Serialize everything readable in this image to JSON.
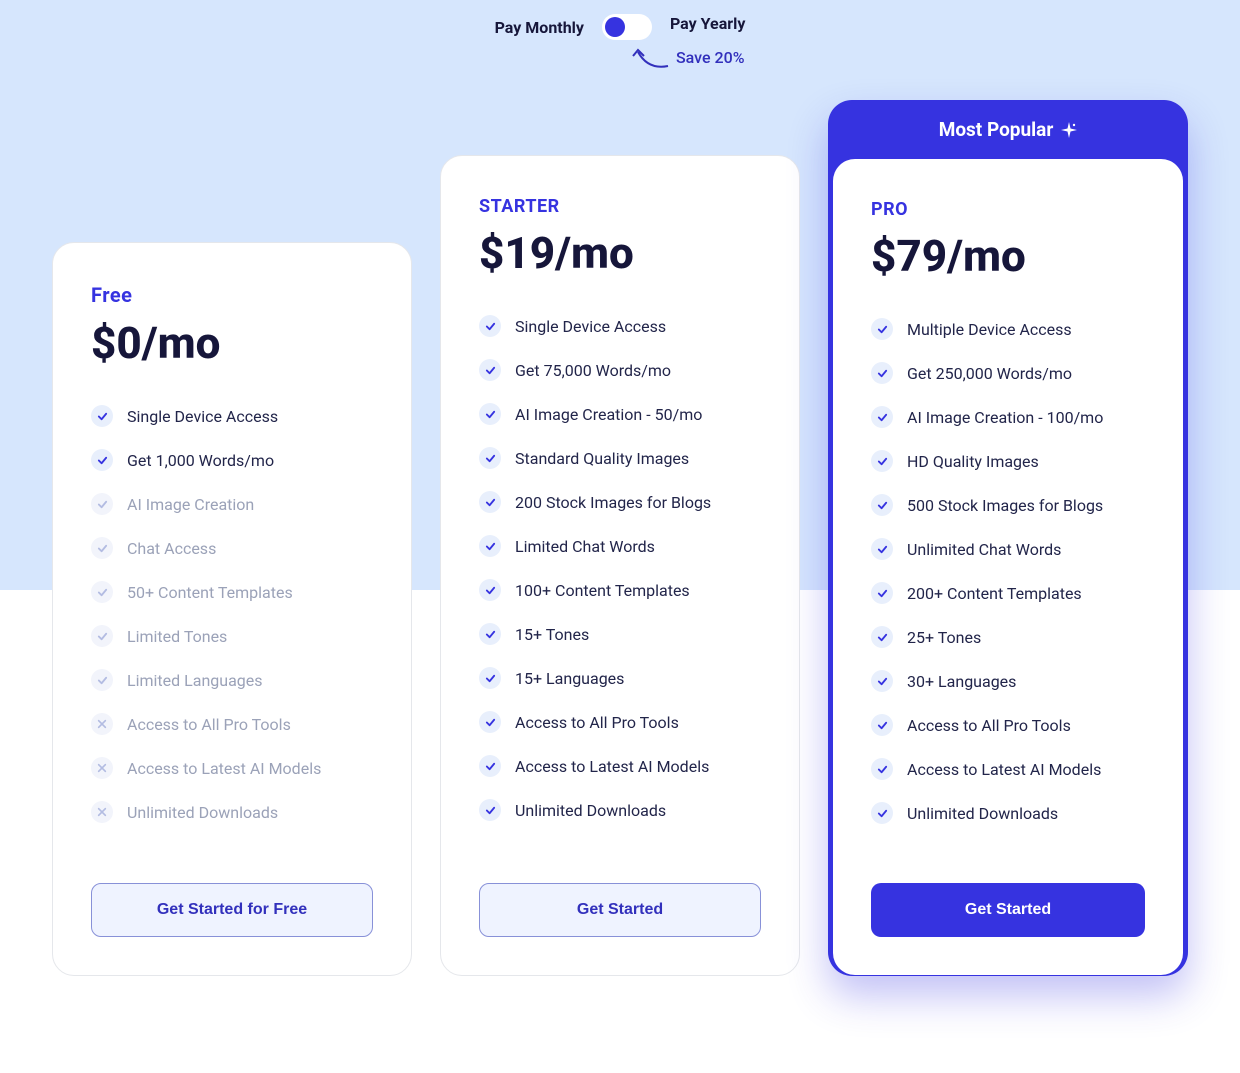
{
  "toggle": {
    "monthly": "Pay Monthly",
    "yearly": "Pay Yearly",
    "saveText": "Save 20%"
  },
  "popularBadge": "Most Popular",
  "tiers": {
    "free": {
      "name": "Free",
      "price": "$0/mo",
      "cta": "Get Started for Free",
      "features": [
        {
          "text": "Single Device Access",
          "icon": "check",
          "enabled": true
        },
        {
          "text": "Get 1,000 Words/mo",
          "icon": "check",
          "enabled": true
        },
        {
          "text": "AI Image Creation",
          "icon": "check",
          "enabled": false
        },
        {
          "text": "Chat Access",
          "icon": "check",
          "enabled": false
        },
        {
          "text": "50+ Content Templates",
          "icon": "check",
          "enabled": false
        },
        {
          "text": "Limited Tones",
          "icon": "check",
          "enabled": false
        },
        {
          "text": "Limited Languages",
          "icon": "check",
          "enabled": false
        },
        {
          "text": "Access to All Pro Tools",
          "icon": "cross",
          "enabled": false
        },
        {
          "text": "Access to Latest AI Models",
          "icon": "cross",
          "enabled": false
        },
        {
          "text": "Unlimited Downloads",
          "icon": "cross",
          "enabled": false
        }
      ]
    },
    "starter": {
      "name": "STARTER",
      "price": "$19/mo",
      "cta": "Get Started",
      "features": [
        {
          "text": "Single Device Access",
          "icon": "check",
          "enabled": true
        },
        {
          "text": "Get 75,000 Words/mo",
          "icon": "check",
          "enabled": true
        },
        {
          "text": "AI Image Creation - 50/mo",
          "icon": "check",
          "enabled": true
        },
        {
          "text": "Standard Quality Images",
          "icon": "check",
          "enabled": true
        },
        {
          "text": "200 Stock Images for Blogs",
          "icon": "check",
          "enabled": true
        },
        {
          "text": "Limited Chat Words",
          "icon": "check",
          "enabled": true
        },
        {
          "text": "100+ Content Templates",
          "icon": "check",
          "enabled": true
        },
        {
          "text": "15+ Tones",
          "icon": "check",
          "enabled": true
        },
        {
          "text": "15+ Languages",
          "icon": "check",
          "enabled": true
        },
        {
          "text": "Access to All Pro Tools",
          "icon": "check",
          "enabled": true
        },
        {
          "text": "Access to Latest AI Models",
          "icon": "check",
          "enabled": true
        },
        {
          "text": "Unlimited Downloads",
          "icon": "check",
          "enabled": true
        }
      ]
    },
    "pro": {
      "name": "PRO",
      "price": "$79/mo",
      "cta": "Get Started",
      "features": [
        {
          "text": "Multiple Device Access",
          "icon": "check",
          "enabled": true
        },
        {
          "text": "Get 250,000 Words/mo",
          "icon": "check",
          "enabled": true
        },
        {
          "text": "AI Image Creation - 100/mo",
          "icon": "check",
          "enabled": true
        },
        {
          "text": "HD Quality Images",
          "icon": "check",
          "enabled": true
        },
        {
          "text": "500 Stock Images for Blogs",
          "icon": "check",
          "enabled": true
        },
        {
          "text": "Unlimited Chat Words",
          "icon": "check",
          "enabled": true
        },
        {
          "text": "200+ Content Templates",
          "icon": "check",
          "enabled": true
        },
        {
          "text": "25+ Tones",
          "icon": "check",
          "enabled": true
        },
        {
          "text": "30+ Languages",
          "icon": "check",
          "enabled": true
        },
        {
          "text": "Access to All Pro Tools",
          "icon": "check",
          "enabled": true
        },
        {
          "text": "Access to Latest AI Models",
          "icon": "check",
          "enabled": true
        },
        {
          "text": "Unlimited Downloads",
          "icon": "check",
          "enabled": true
        }
      ]
    }
  }
}
